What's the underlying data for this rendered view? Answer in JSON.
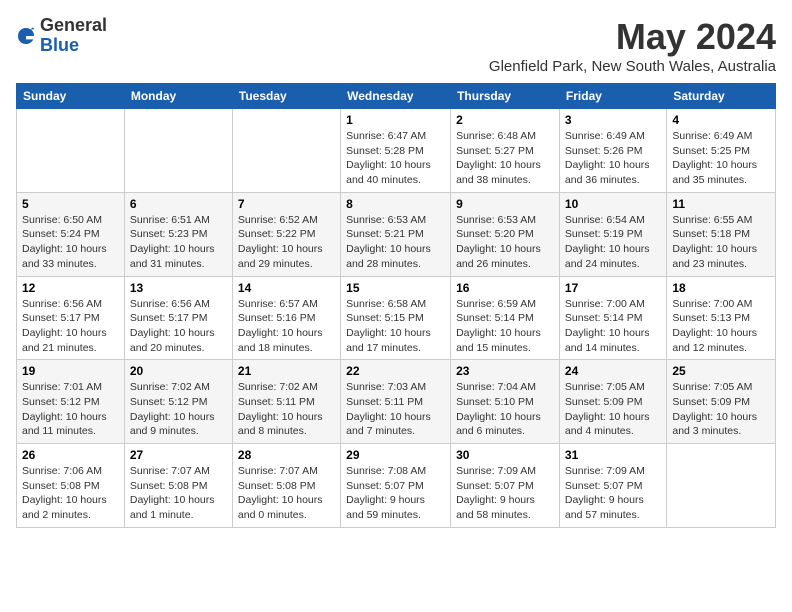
{
  "header": {
    "logo_general": "General",
    "logo_blue": "Blue",
    "month_year": "May 2024",
    "location": "Glenfield Park, New South Wales, Australia"
  },
  "days_of_week": [
    "Sunday",
    "Monday",
    "Tuesday",
    "Wednesday",
    "Thursday",
    "Friday",
    "Saturday"
  ],
  "weeks": [
    [
      {
        "day": "",
        "info": ""
      },
      {
        "day": "",
        "info": ""
      },
      {
        "day": "",
        "info": ""
      },
      {
        "day": "1",
        "info": "Sunrise: 6:47 AM\nSunset: 5:28 PM\nDaylight: 10 hours\nand 40 minutes."
      },
      {
        "day": "2",
        "info": "Sunrise: 6:48 AM\nSunset: 5:27 PM\nDaylight: 10 hours\nand 38 minutes."
      },
      {
        "day": "3",
        "info": "Sunrise: 6:49 AM\nSunset: 5:26 PM\nDaylight: 10 hours\nand 36 minutes."
      },
      {
        "day": "4",
        "info": "Sunrise: 6:49 AM\nSunset: 5:25 PM\nDaylight: 10 hours\nand 35 minutes."
      }
    ],
    [
      {
        "day": "5",
        "info": "Sunrise: 6:50 AM\nSunset: 5:24 PM\nDaylight: 10 hours\nand 33 minutes."
      },
      {
        "day": "6",
        "info": "Sunrise: 6:51 AM\nSunset: 5:23 PM\nDaylight: 10 hours\nand 31 minutes."
      },
      {
        "day": "7",
        "info": "Sunrise: 6:52 AM\nSunset: 5:22 PM\nDaylight: 10 hours\nand 29 minutes."
      },
      {
        "day": "8",
        "info": "Sunrise: 6:53 AM\nSunset: 5:21 PM\nDaylight: 10 hours\nand 28 minutes."
      },
      {
        "day": "9",
        "info": "Sunrise: 6:53 AM\nSunset: 5:20 PM\nDaylight: 10 hours\nand 26 minutes."
      },
      {
        "day": "10",
        "info": "Sunrise: 6:54 AM\nSunset: 5:19 PM\nDaylight: 10 hours\nand 24 minutes."
      },
      {
        "day": "11",
        "info": "Sunrise: 6:55 AM\nSunset: 5:18 PM\nDaylight: 10 hours\nand 23 minutes."
      }
    ],
    [
      {
        "day": "12",
        "info": "Sunrise: 6:56 AM\nSunset: 5:17 PM\nDaylight: 10 hours\nand 21 minutes."
      },
      {
        "day": "13",
        "info": "Sunrise: 6:56 AM\nSunset: 5:17 PM\nDaylight: 10 hours\nand 20 minutes."
      },
      {
        "day": "14",
        "info": "Sunrise: 6:57 AM\nSunset: 5:16 PM\nDaylight: 10 hours\nand 18 minutes."
      },
      {
        "day": "15",
        "info": "Sunrise: 6:58 AM\nSunset: 5:15 PM\nDaylight: 10 hours\nand 17 minutes."
      },
      {
        "day": "16",
        "info": "Sunrise: 6:59 AM\nSunset: 5:14 PM\nDaylight: 10 hours\nand 15 minutes."
      },
      {
        "day": "17",
        "info": "Sunrise: 7:00 AM\nSunset: 5:14 PM\nDaylight: 10 hours\nand 14 minutes."
      },
      {
        "day": "18",
        "info": "Sunrise: 7:00 AM\nSunset: 5:13 PM\nDaylight: 10 hours\nand 12 minutes."
      }
    ],
    [
      {
        "day": "19",
        "info": "Sunrise: 7:01 AM\nSunset: 5:12 PM\nDaylight: 10 hours\nand 11 minutes."
      },
      {
        "day": "20",
        "info": "Sunrise: 7:02 AM\nSunset: 5:12 PM\nDaylight: 10 hours\nand 9 minutes."
      },
      {
        "day": "21",
        "info": "Sunrise: 7:02 AM\nSunset: 5:11 PM\nDaylight: 10 hours\nand 8 minutes."
      },
      {
        "day": "22",
        "info": "Sunrise: 7:03 AM\nSunset: 5:11 PM\nDaylight: 10 hours\nand 7 minutes."
      },
      {
        "day": "23",
        "info": "Sunrise: 7:04 AM\nSunset: 5:10 PM\nDaylight: 10 hours\nand 6 minutes."
      },
      {
        "day": "24",
        "info": "Sunrise: 7:05 AM\nSunset: 5:09 PM\nDaylight: 10 hours\nand 4 minutes."
      },
      {
        "day": "25",
        "info": "Sunrise: 7:05 AM\nSunset: 5:09 PM\nDaylight: 10 hours\nand 3 minutes."
      }
    ],
    [
      {
        "day": "26",
        "info": "Sunrise: 7:06 AM\nSunset: 5:08 PM\nDaylight: 10 hours\nand 2 minutes."
      },
      {
        "day": "27",
        "info": "Sunrise: 7:07 AM\nSunset: 5:08 PM\nDaylight: 10 hours\nand 1 minute."
      },
      {
        "day": "28",
        "info": "Sunrise: 7:07 AM\nSunset: 5:08 PM\nDaylight: 10 hours\nand 0 minutes."
      },
      {
        "day": "29",
        "info": "Sunrise: 7:08 AM\nSunset: 5:07 PM\nDaylight: 9 hours\nand 59 minutes."
      },
      {
        "day": "30",
        "info": "Sunrise: 7:09 AM\nSunset: 5:07 PM\nDaylight: 9 hours\nand 58 minutes."
      },
      {
        "day": "31",
        "info": "Sunrise: 7:09 AM\nSunset: 5:07 PM\nDaylight: 9 hours\nand 57 minutes."
      },
      {
        "day": "",
        "info": ""
      }
    ]
  ]
}
